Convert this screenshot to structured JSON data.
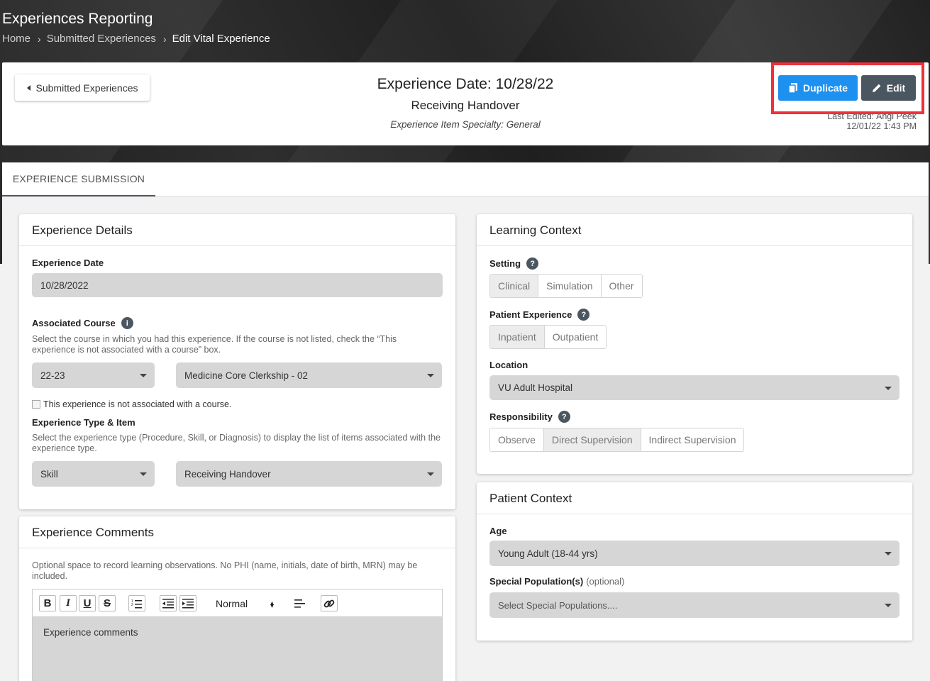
{
  "app": {
    "title": "Experiences Reporting",
    "breadcrumb": [
      "Home",
      "Submitted Experiences",
      "Edit Vital Experience"
    ]
  },
  "header": {
    "back_label": "Submitted Experiences",
    "experience_date": "Experience Date: 10/28/22",
    "experience_name": "Receiving Handover",
    "specialty": "Experience Item Specialty: General",
    "duplicate_label": "Duplicate",
    "edit_label": "Edit",
    "last_edited": "Last Edited: Angi Peek",
    "last_edited_time": "12/01/22 1:43 PM"
  },
  "tabs": [
    {
      "label": "EXPERIENCE SUBMISSION",
      "active": true
    }
  ],
  "details": {
    "title": "Experience Details",
    "date_label": "Experience Date",
    "date_value": "10/28/2022",
    "course_label": "Associated Course",
    "course_help": "Select the course in which you had this experience. If the course is not listed, check the “This experience is not associated with a course” box.",
    "year_value": "22-23",
    "course_value": "Medicine Core Clerkship - 02",
    "no_course_label": "This experience is not associated with a course.",
    "type_label": "Experience Type & Item",
    "type_help": "Select the experience type (Procedure, Skill, or Diagnosis) to display the list of items associated with the experience type.",
    "type_value": "Skill",
    "item_value": "Receiving Handover"
  },
  "comments": {
    "title": "Experience Comments",
    "help": "Optional space to record learning observations. No PHI (name, initials, date of birth, MRN) may be included.",
    "format_value": "Normal",
    "editor_text": "Experience comments"
  },
  "learning": {
    "title": "Learning Context",
    "setting_label": "Setting",
    "setting_options": [
      "Clinical",
      "Simulation",
      "Other"
    ],
    "setting_selected": "Clinical",
    "patient_exp_label": "Patient Experience",
    "patient_exp_options": [
      "Inpatient",
      "Outpatient"
    ],
    "patient_exp_selected": "Inpatient",
    "location_label": "Location",
    "location_value": "VU Adult Hospital",
    "responsibility_label": "Responsibility",
    "responsibility_options": [
      "Observe",
      "Direct Supervision",
      "Indirect Supervision"
    ],
    "responsibility_selected": "Direct Supervision"
  },
  "patient": {
    "title": "Patient Context",
    "age_label": "Age",
    "age_value": "Young Adult (18-44 yrs)",
    "special_label": "Special Population(s)",
    "special_optional": "(optional)",
    "special_placeholder": "Select Special Populations...."
  },
  "colors": {
    "duplicate": "#1e90ef",
    "edit": "#4a5660",
    "highlight": "#f0303a"
  }
}
